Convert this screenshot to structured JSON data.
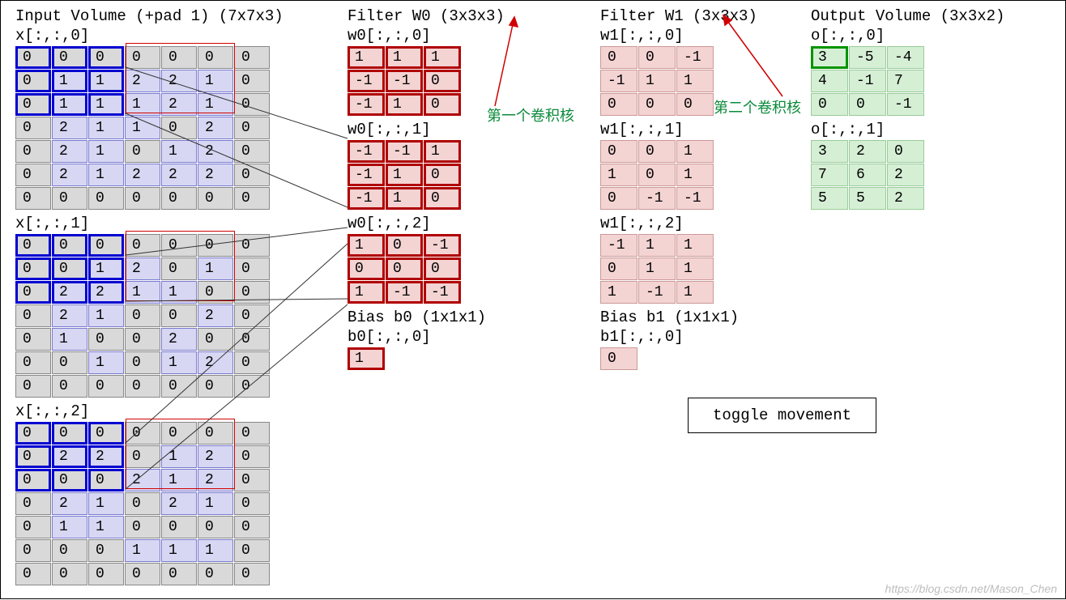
{
  "headers": {
    "input": "Input Volume (+pad 1) (7x7x3)",
    "w0": "Filter W0 (3x3x3)",
    "w1": "Filter W1 (3x3x3)",
    "out": "Output Volume (3x3x2)",
    "bias0": "Bias b0 (1x1x1)",
    "bias1": "Bias b1 (1x1x1)"
  },
  "slice_labels": {
    "x0": "x[:,:,0]",
    "x1": "x[:,:,1]",
    "x2": "x[:,:,2]",
    "w00": "w0[:,:,0]",
    "w01": "w0[:,:,1]",
    "w02": "w0[:,:,2]",
    "w10": "w1[:,:,0]",
    "w11": "w1[:,:,1]",
    "w12": "w1[:,:,2]",
    "b0": "b0[:,:,0]",
    "b1": "b1[:,:,0]",
    "o0": "o[:,:,0]",
    "o1": "o[:,:,1]"
  },
  "input": {
    "x0": [
      [
        0,
        0,
        0,
        0,
        0,
        0,
        0
      ],
      [
        0,
        1,
        1,
        2,
        2,
        1,
        0
      ],
      [
        0,
        1,
        1,
        1,
        2,
        1,
        0
      ],
      [
        0,
        2,
        1,
        1,
        0,
        2,
        0
      ],
      [
        0,
        2,
        1,
        0,
        1,
        2,
        0
      ],
      [
        0,
        2,
        1,
        2,
        2,
        2,
        0
      ],
      [
        0,
        0,
        0,
        0,
        0,
        0,
        0
      ]
    ],
    "x1": [
      [
        0,
        0,
        0,
        0,
        0,
        0,
        0
      ],
      [
        0,
        0,
        1,
        2,
        0,
        1,
        0
      ],
      [
        0,
        2,
        2,
        1,
        1,
        0,
        0
      ],
      [
        0,
        2,
        1,
        0,
        0,
        2,
        0
      ],
      [
        0,
        1,
        0,
        0,
        2,
        0,
        0
      ],
      [
        0,
        0,
        1,
        0,
        1,
        2,
        0
      ],
      [
        0,
        0,
        0,
        0,
        0,
        0,
        0
      ]
    ],
    "x2": [
      [
        0,
        0,
        0,
        0,
        0,
        0,
        0
      ],
      [
        0,
        2,
        2,
        0,
        1,
        2,
        0
      ],
      [
        0,
        0,
        0,
        2,
        1,
        2,
        0
      ],
      [
        0,
        2,
        1,
        0,
        2,
        1,
        0
      ],
      [
        0,
        1,
        1,
        0,
        0,
        0,
        0
      ],
      [
        0,
        0,
        0,
        1,
        1,
        1,
        0
      ],
      [
        0,
        0,
        0,
        0,
        0,
        0,
        0
      ]
    ]
  },
  "filters": {
    "w0": {
      "d0": [
        [
          1,
          1,
          1
        ],
        [
          -1,
          -1,
          0
        ],
        [
          -1,
          1,
          0
        ]
      ],
      "d1": [
        [
          -1,
          -1,
          1
        ],
        [
          -1,
          1,
          0
        ],
        [
          -1,
          1,
          0
        ]
      ],
      "d2": [
        [
          1,
          0,
          -1
        ],
        [
          0,
          0,
          0
        ],
        [
          1,
          -1,
          -1
        ]
      ]
    },
    "w1": {
      "d0": [
        [
          0,
          0,
          -1
        ],
        [
          -1,
          1,
          1
        ],
        [
          0,
          0,
          0
        ]
      ],
      "d1": [
        [
          0,
          0,
          1
        ],
        [
          1,
          0,
          1
        ],
        [
          0,
          -1,
          -1
        ]
      ],
      "d2": [
        [
          -1,
          1,
          1
        ],
        [
          0,
          1,
          1
        ],
        [
          1,
          -1,
          1
        ]
      ]
    }
  },
  "bias": {
    "b0": [
      [
        1
      ]
    ],
    "b1": [
      [
        0
      ]
    ]
  },
  "output": {
    "o0": [
      [
        3,
        -5,
        -4
      ],
      [
        4,
        -1,
        7
      ],
      [
        0,
        0,
        -1
      ]
    ],
    "o1": [
      [
        3,
        2,
        0
      ],
      [
        7,
        6,
        2
      ],
      [
        5,
        5,
        2
      ]
    ]
  },
  "highlight": {
    "input_win": {
      "rows": [
        0,
        1,
        2
      ],
      "cols": [
        0,
        1,
        2
      ]
    },
    "output_cell": {
      "slice": "o0",
      "r": 0,
      "c": 0
    }
  },
  "annotations": {
    "first_kernel": "第一个卷积核",
    "second_kernel": "第二个卷积核"
  },
  "button": {
    "label": "toggle movement"
  },
  "watermark": "https://blog.csdn.net/Mason_Chen"
}
